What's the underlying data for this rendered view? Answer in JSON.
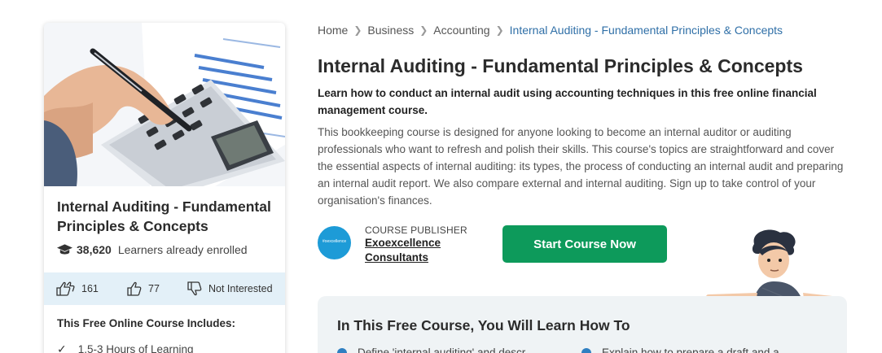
{
  "card": {
    "title": "Internal Auditing - Fundamental Principles & Concepts",
    "enrolled_count": "38,620",
    "enrolled_label": "Learners already enrolled",
    "likes": "161",
    "thumbs_up": "77",
    "not_interested": "Not Interested",
    "includes_title": "This Free Online Course Includes:",
    "includes": [
      "1.5-3 Hours of Learning"
    ]
  },
  "breadcrumb": [
    "Home",
    "Business",
    "Accounting",
    "Internal Auditing - Fundamental Principles & Concepts"
  ],
  "course": {
    "title": "Internal Auditing - Fundamental Principles & Concepts",
    "subtitle": "Learn how to conduct an internal audit using accounting techniques in this free online financial management course.",
    "description": "This bookkeeping course is designed for anyone looking to become an internal auditor or auditing professionals who want to refresh and polish their skills. This course's topics are straightforward and cover the essential aspects of internal auditing: its types, the process of conducting an internal audit and preparing an internal audit report. We also compare external and internal auditing. Sign up to take control of your organisation's finances."
  },
  "publisher": {
    "label": "COURSE PUBLISHER",
    "name_line1": "Exoexcellence",
    "name_line2": "Consultants",
    "logo_text": "#oexcellence"
  },
  "cta": {
    "start_label": "Start Course Now"
  },
  "learn": {
    "title": "In This Free Course, You Will Learn How To",
    "items": [
      "Define 'internal auditing' and descr...",
      "Explain how to prepare a draft and a..."
    ]
  },
  "colors": {
    "accent_green": "#0d9a5b",
    "link_blue": "#2f6fa7",
    "publisher_blue": "#1d9bd7",
    "reactions_bg": "#e3f0f8"
  }
}
